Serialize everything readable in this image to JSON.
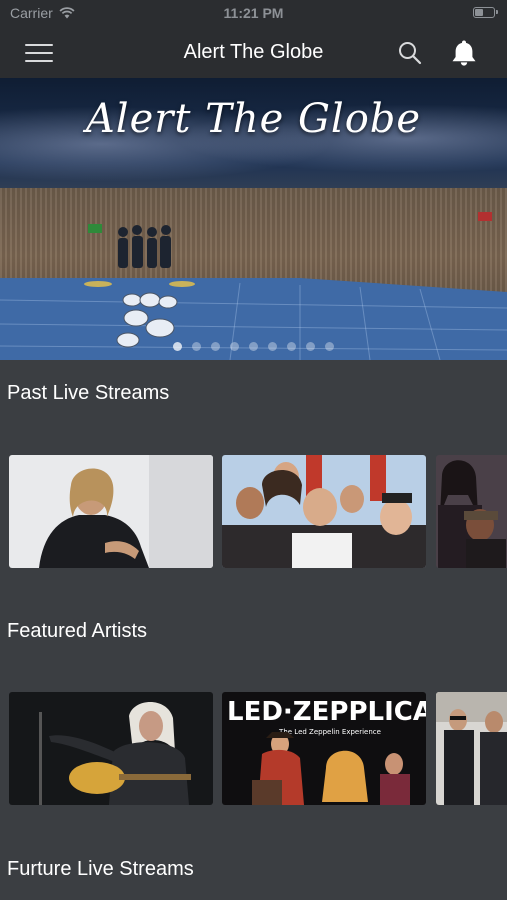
{
  "status_bar": {
    "carrier": "Carrier",
    "time": "11:21 PM"
  },
  "nav": {
    "title": "Alert The Globe",
    "menu_icon": "hamburger-menu-icon",
    "search_icon": "search-icon",
    "bell_icon": "bell-icon"
  },
  "hero": {
    "banner_text": "Alert The Globe",
    "slide_count": 9,
    "active_slide": 1
  },
  "sections": [
    {
      "title": "Past Live Streams"
    },
    {
      "title": "Featured Artists"
    },
    {
      "title": "Furture Live Streams"
    }
  ],
  "colors": {
    "background": "#3b3e42",
    "nav": "#2b2d30",
    "text": "#ffffff"
  }
}
